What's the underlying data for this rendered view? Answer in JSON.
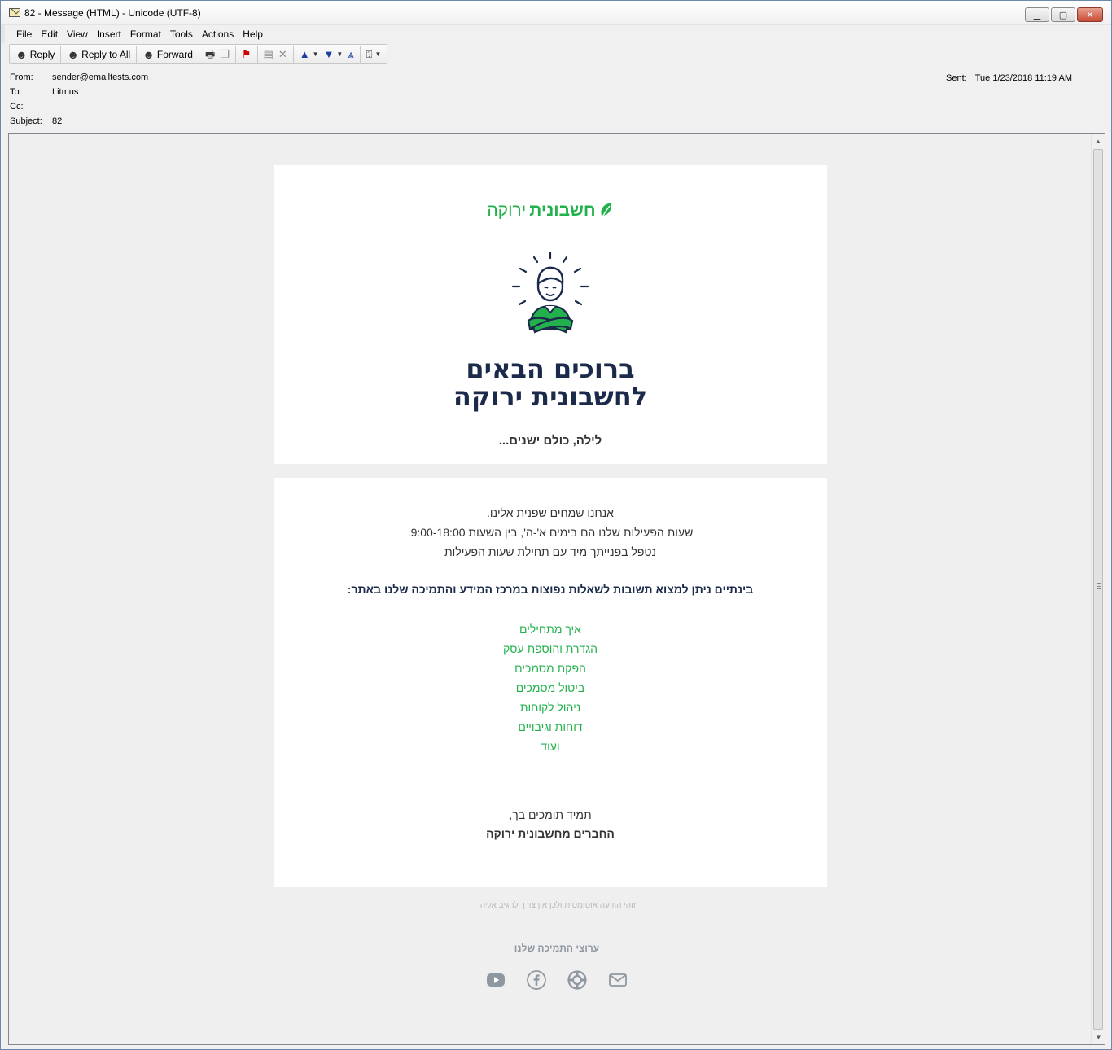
{
  "window": {
    "title": "82 - Message (HTML)  - Unicode (UTF-8)"
  },
  "menu": [
    "File",
    "Edit",
    "View",
    "Insert",
    "Format",
    "Tools",
    "Actions",
    "Help"
  ],
  "toolbar": {
    "reply": "Reply",
    "reply_all": "Reply to All",
    "forward": "Forward"
  },
  "headers": {
    "from_label": "From:",
    "from_value": "sender@emailtests.com",
    "to_label": "To:",
    "to_value": "Litmus",
    "cc_label": "Cc:",
    "cc_value": "",
    "subject_label": "Subject:",
    "subject_value": "82",
    "sent_label": "Sent:",
    "sent_value": "Tue 1/23/2018 11:19 AM"
  },
  "email": {
    "logo_bold": "חשבונית",
    "logo_light": "ירוקה",
    "headline_1": "ברוכים הבאים",
    "headline_2": "לחשבונית ירוקה",
    "subline": "לילה, כולם ישנים...",
    "body_1": "אנחנו שמחים שפנית אלינו.",
    "body_2": "שעות הפעילות שלנו הם בימים א'-ה', בין השעות 9:00-18:00.",
    "body_3": "נטפל בפנייתך מיד עם תחילת שעות הפעילות",
    "faq_intro": "בינתיים ניתן למצוא תשובות לשאלות נפוצות במרכז המידע והתמיכה שלנו באתר:",
    "links": [
      "איך מתחילים",
      "הגדרת והוספת עסק",
      "הפקת מסמכים",
      "ביטול מסמכים",
      "ניהול לקוחות",
      "דוחות וגיבויים",
      "ועוד"
    ],
    "sign_1": "תמיד תומכים בך,",
    "sign_2": "החברים מחשבונית ירוקה",
    "auto_note": "זוהי הודעה אוטומטית ולכן אין צורך להגיב אליה.",
    "support_title": "ערוצי התמיכה שלנו",
    "social_icons": [
      "youtube-icon",
      "facebook-icon",
      "lifebuoy-icon",
      "mail-icon"
    ],
    "colors": {
      "green": "#22b14c",
      "navy": "#1b2a4a",
      "grey": "#8f98a1"
    }
  }
}
